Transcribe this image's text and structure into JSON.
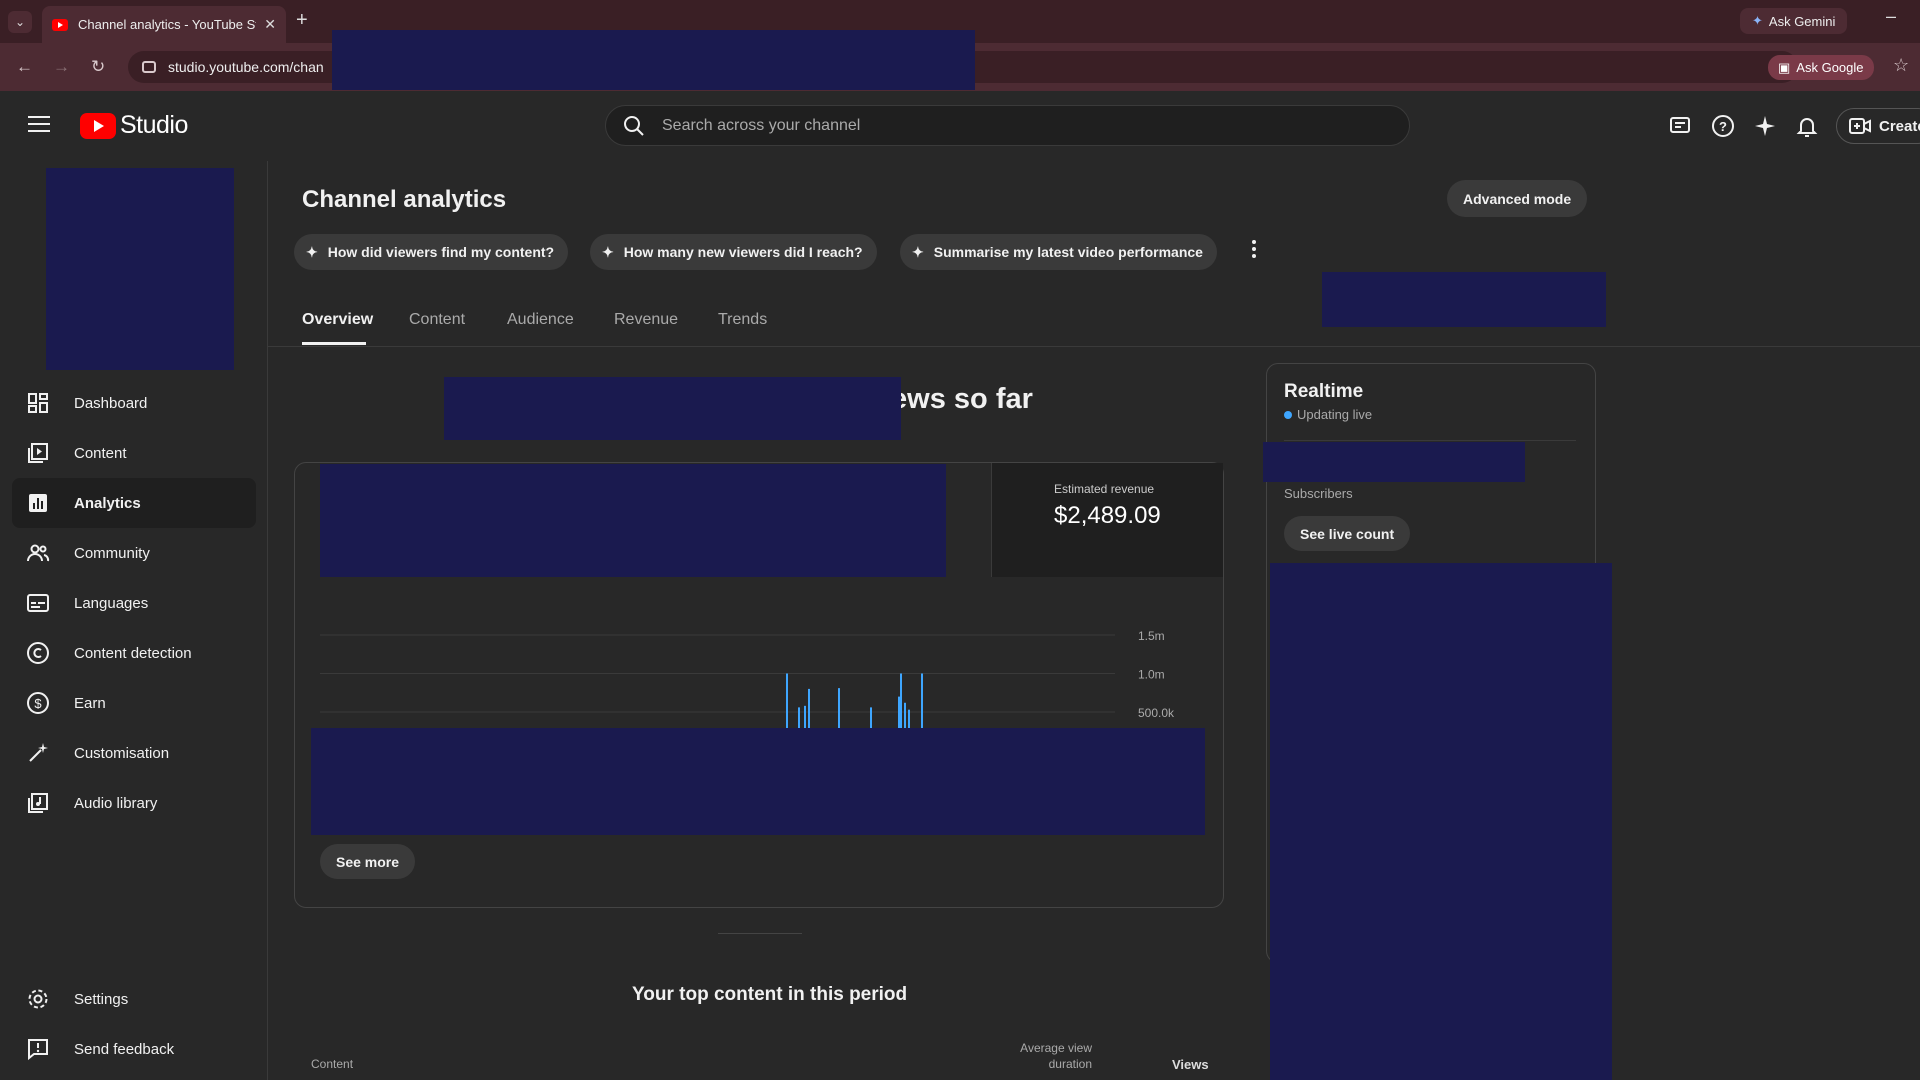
{
  "browser": {
    "tab_title": "Channel analytics - YouTube Studio",
    "tab_title_visible": "Channel analytics - YouTube Stu",
    "url": "studio.youtube.com/chan",
    "ask_gemini": "Ask Gemini",
    "ask_google": "Ask Google"
  },
  "header": {
    "logo_text": "Studio",
    "search_placeholder": "Search across your channel",
    "create_label": "Create"
  },
  "sidebar": {
    "items": [
      {
        "label": "Dashboard",
        "icon": "dashboard-icon"
      },
      {
        "label": "Content",
        "icon": "content-icon"
      },
      {
        "label": "Analytics",
        "icon": "analytics-icon",
        "active": true
      },
      {
        "label": "Community",
        "icon": "community-icon"
      },
      {
        "label": "Languages",
        "icon": "subtitles-icon"
      },
      {
        "label": "Content detection",
        "icon": "copyright-icon"
      },
      {
        "label": "Earn",
        "icon": "dollar-icon"
      },
      {
        "label": "Customisation",
        "icon": "magic-wand-icon"
      },
      {
        "label": "Audio library",
        "icon": "audio-library-icon"
      }
    ],
    "bottom": [
      {
        "label": "Settings",
        "icon": "gear-icon"
      },
      {
        "label": "Send feedback",
        "icon": "feedback-icon"
      }
    ]
  },
  "main": {
    "title": "Channel analytics",
    "advanced_mode": "Advanced mode",
    "chips": [
      "How did viewers find my content?",
      "How many new viewers did I reach?",
      "Summarise my latest video performance"
    ],
    "tabs": [
      "Overview",
      "Content",
      "Audience",
      "Revenue",
      "Trends"
    ],
    "active_tab": "Overview",
    "headline_visible": "iews so far",
    "revenue": {
      "label": "Estimated revenue",
      "value": "$2,489.09"
    },
    "see_more": "See more",
    "realtime": {
      "title": "Realtime",
      "status": "Updating live",
      "subscribers_label": "Subscribers",
      "see_live_count": "See live count"
    },
    "top_content": {
      "title": "Your top content in this period",
      "col_content": "Content",
      "col_avg_view_duration": "Average view duration",
      "col_views": "Views"
    }
  },
  "chart_data": {
    "type": "bar",
    "y_ticks": [
      "1.5m",
      "1.0m",
      "500.0k"
    ],
    "ylim": [
      0,
      1500000
    ],
    "series_color": "#3ea6ff",
    "values_visible_above_500k": [
      1000000,
      560000,
      580000,
      800000,
      810000,
      560000,
      700000,
      1000000,
      620000,
      530000,
      1000000
    ]
  },
  "colors": {
    "background": "#282828",
    "accent_live": "#3ea6ff",
    "brand_red": "#ff0000",
    "redaction": "#1a1a4f"
  }
}
